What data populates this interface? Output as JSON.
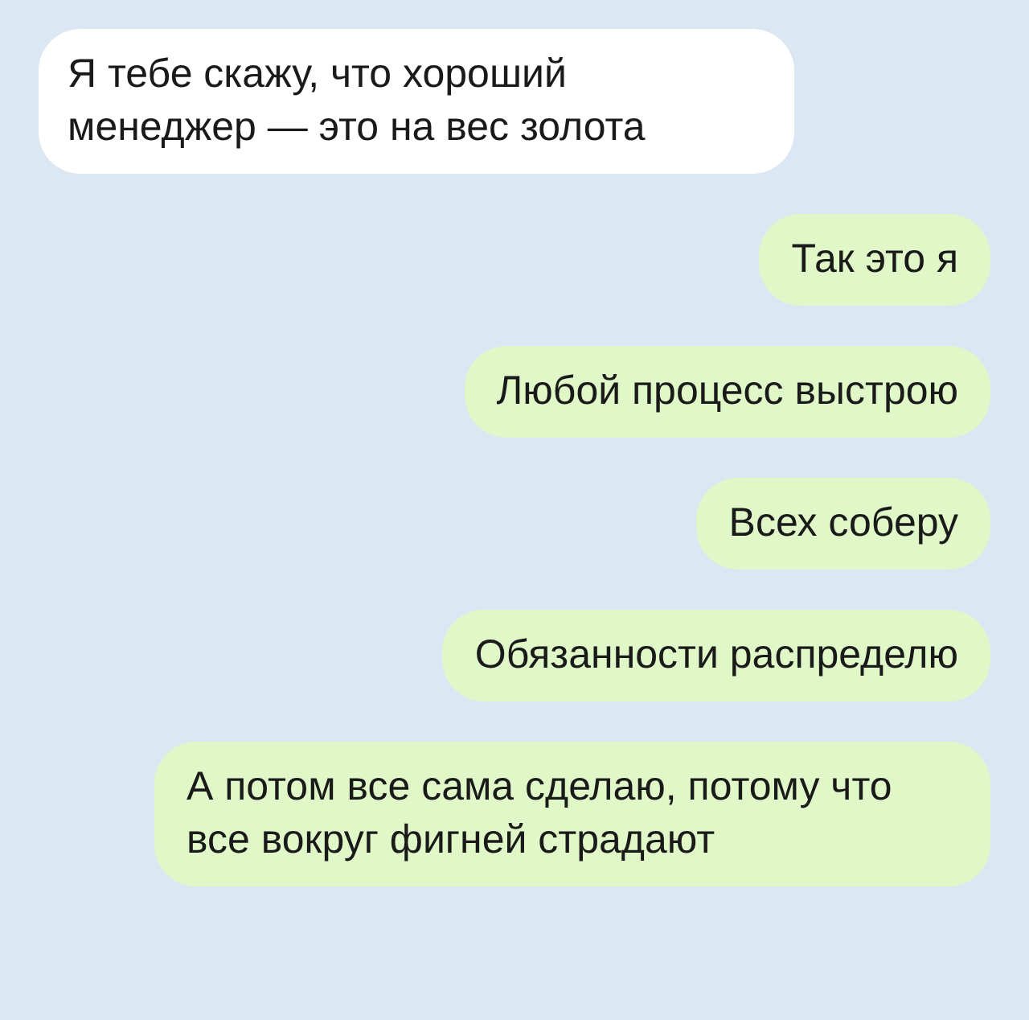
{
  "messages": [
    {
      "kind": "incoming",
      "text": "Я тебе скажу, что хороший менеджер — это на вес золота"
    },
    {
      "kind": "outgoing",
      "text": "Так это я"
    },
    {
      "kind": "outgoing",
      "text": "Любой процесс выстрою"
    },
    {
      "kind": "outgoing",
      "text": "Всех соберу"
    },
    {
      "kind": "outgoing",
      "text": "Обязанности распределю"
    },
    {
      "kind": "outgoing",
      "text": "А потом все сама сделаю, потому что все вокруг фигней страдают"
    }
  ]
}
